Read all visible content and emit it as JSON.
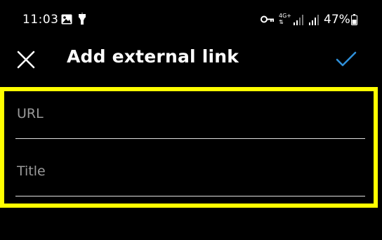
{
  "status_bar": {
    "time": "11:03",
    "network_type": "4G+",
    "battery": "47%",
    "icons": [
      "gallery-icon",
      "torch-icon",
      "key-icon",
      "signal-icon",
      "signal-icon",
      "battery-icon"
    ]
  },
  "app_bar": {
    "title": "Add external link",
    "close_icon": "close-icon",
    "confirm_icon": "check-icon",
    "accent_color": "#2f8fd8"
  },
  "form": {
    "highlight_color": "#ffff00",
    "url": {
      "value": "",
      "placeholder": "URL"
    },
    "title": {
      "value": "",
      "placeholder": "Title"
    }
  }
}
